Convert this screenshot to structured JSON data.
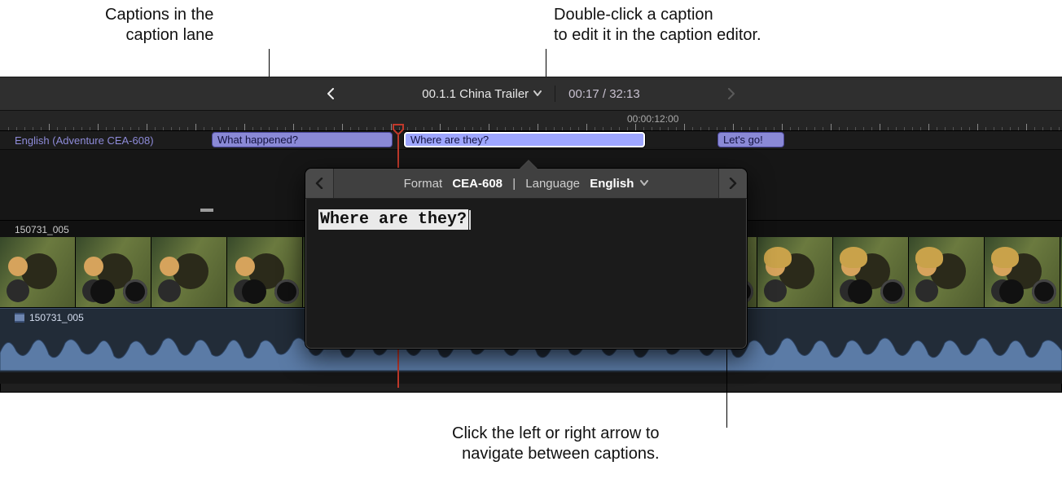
{
  "callouts": {
    "top_left": "Captions in the\ncaption lane",
    "top_right": "Double-click a caption\nto edit it in the caption editor.",
    "bottom": "Click the left or right arrow to\nnavigate between captions."
  },
  "titlebar": {
    "project_name": "00.1.1 China Trailer",
    "timecode": "00:17 / 32:13"
  },
  "ruler": {
    "label": "00:00:12:00"
  },
  "captions": {
    "lane_label": "English (Adventure CEA-608)",
    "items": [
      {
        "text": "What happened?",
        "selected": false
      },
      {
        "text": "Where are they?",
        "selected": true
      },
      {
        "text": "Let's go!",
        "selected": false
      }
    ]
  },
  "video_clip": {
    "label": "150731_005"
  },
  "audio_clip": {
    "label": "150731_005"
  },
  "popover": {
    "format_label": "Format",
    "format_value": "CEA-608",
    "separator": "|",
    "lang_label": "Language",
    "lang_value": "English",
    "text": "Where are they?"
  }
}
